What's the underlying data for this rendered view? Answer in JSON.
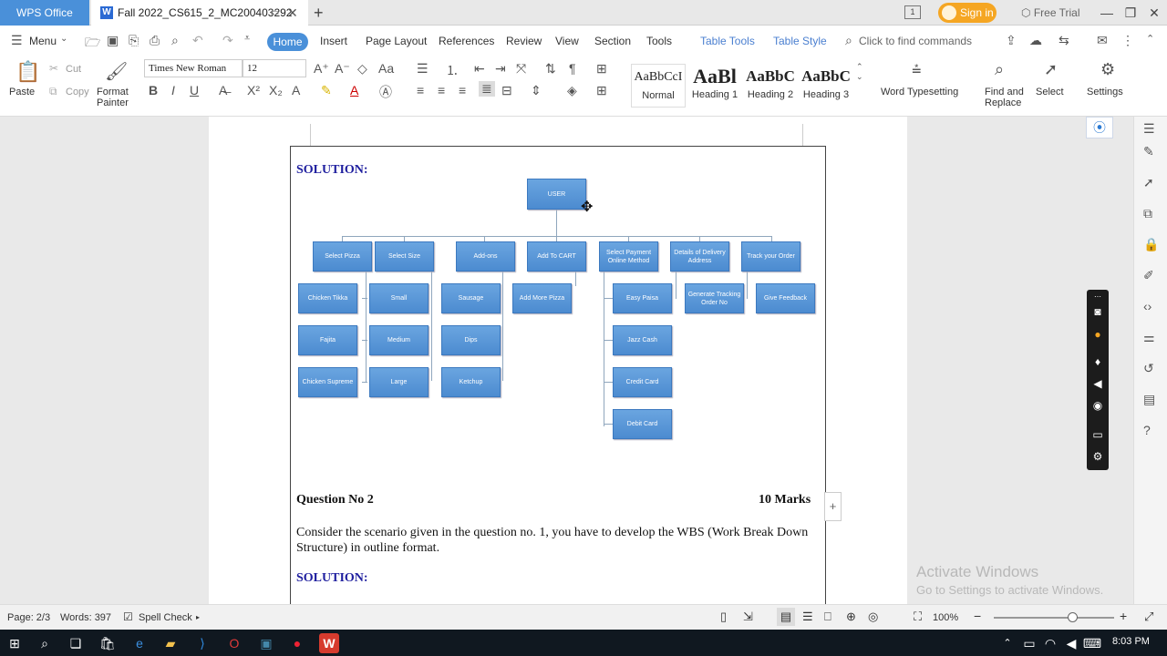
{
  "titlebar": {
    "app_tab": "WPS Office",
    "doc_tab": "Fall 2022_CS615_2_MC200403292",
    "new_tab": "+",
    "page_indicator": "1",
    "sign_in": "Sign in",
    "free_trial": "Free Trial"
  },
  "menu": {
    "menu_label": "Menu",
    "tabs": [
      "Home",
      "Insert",
      "Page Layout",
      "References",
      "Review",
      "View",
      "Section",
      "Tools"
    ],
    "context_tabs": [
      "Table Tools",
      "Table Style"
    ],
    "search_placeholder": "Click to find commands"
  },
  "ribbon": {
    "paste": "Paste",
    "cut": "Cut",
    "copy": "Copy",
    "format_painter": "Format Painter",
    "font_name": "Times New Roman",
    "font_size": "12",
    "styles": [
      {
        "preview": "AaBbCcI",
        "label": "Normal"
      },
      {
        "preview": "AaBl",
        "label": "Heading 1"
      },
      {
        "preview": "AaBbC",
        "label": "Heading 2"
      },
      {
        "preview": "AaBbC",
        "label": "Heading 3"
      }
    ],
    "word_typesetting": "Word Typesetting",
    "find_replace": "Find and Replace",
    "select": "Select",
    "settings": "Settings"
  },
  "document": {
    "solution1": "SOLUTION:",
    "diagram": {
      "root": "USER",
      "columns": [
        {
          "head": "Select Pizza",
          "children": [
            "Chicken Tikka",
            "Fajita",
            "Chicken Supreme"
          ]
        },
        {
          "head": "Select Size",
          "children": [
            "Small",
            "Medium",
            "Large"
          ]
        },
        {
          "head": "Add-ons",
          "children": [
            "Sausage",
            "Dips",
            "Ketchup"
          ]
        },
        {
          "head": "Add To CART",
          "children": [
            "Add More Pizza"
          ]
        },
        {
          "head": "Select Payment Online Method",
          "children": [
            "Easy Paisa",
            "Jazz Cash",
            "Credit Card",
            "Debit Card"
          ]
        },
        {
          "head": "Details of Delivery Address",
          "children": [
            "Generate Tracking Order No"
          ]
        },
        {
          "head": "Track your Order",
          "children": [
            "Give Feedback"
          ]
        }
      ]
    },
    "question_title": "Question No 2",
    "marks": "10 Marks",
    "question_text": "Consider the scenario given in the question no. 1, you have to develop the WBS (Work Break Down Structure) in outline format.",
    "solution2": "SOLUTION:"
  },
  "statusbar": {
    "page": "Page: 2/3",
    "words": "Words: 397",
    "spell_check": "Spell Check",
    "zoom": "100%",
    "zoom_level": 0.65
  },
  "watermark": {
    "line1": "Activate Windows",
    "line2": "Go to Settings to activate Windows."
  },
  "taskbar": {
    "time": "8:03 PM"
  },
  "colors": {
    "accent": "#4a90d9",
    "node_fill": "#5b9bd5",
    "solution_text": "#1f1f9f"
  }
}
